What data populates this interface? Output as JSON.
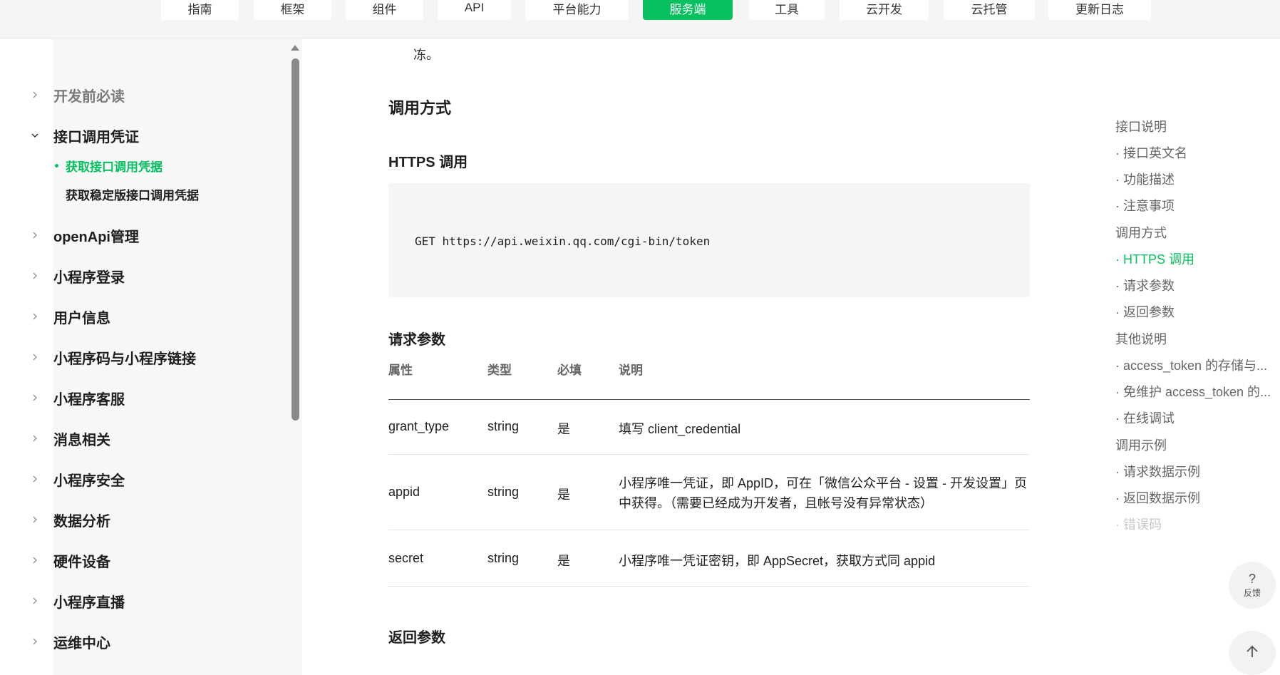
{
  "topnav": {
    "tabs": [
      {
        "label": "指南"
      },
      {
        "label": "框架"
      },
      {
        "label": "组件"
      },
      {
        "label": "API"
      },
      {
        "label": "平台能力"
      },
      {
        "label": "服务端",
        "active": true
      },
      {
        "label": "工具"
      },
      {
        "label": "云开发"
      },
      {
        "label": "云托管"
      },
      {
        "label": "更新日志"
      }
    ]
  },
  "sidebar": {
    "items": [
      {
        "label": "开发前必读",
        "expanded": false
      },
      {
        "label": "接口调用凭证",
        "expanded": true
      },
      {
        "label": "openApi管理",
        "expanded": false
      },
      {
        "label": "小程序登录",
        "expanded": false
      },
      {
        "label": "用户信息",
        "expanded": false
      },
      {
        "label": "小程序码与小程序链接",
        "expanded": false
      },
      {
        "label": "小程序客服",
        "expanded": false
      },
      {
        "label": "消息相关",
        "expanded": false
      },
      {
        "label": "小程序安全",
        "expanded": false
      },
      {
        "label": "数据分析",
        "expanded": false
      },
      {
        "label": "硬件设备",
        "expanded": false
      },
      {
        "label": "小程序直播",
        "expanded": false
      },
      {
        "label": "运维中心",
        "expanded": false
      }
    ],
    "subitems": [
      {
        "label": "获取接口调用凭据",
        "active": true
      },
      {
        "label": "获取稳定版接口调用凭据",
        "active": false
      }
    ]
  },
  "main": {
    "fragment_text": "冻。",
    "section_call": "调用方式",
    "section_https": "HTTPS 调用",
    "code": "GET https://api.weixin.qq.com/cgi-bin/token",
    "section_request": "请求参数",
    "table": {
      "headers": [
        "属性",
        "类型",
        "必填",
        "说明"
      ],
      "rows": [
        {
          "name": "grant_type",
          "type": "string",
          "required": "是",
          "desc": "填写 client_credential"
        },
        {
          "name": "appid",
          "type": "string",
          "required": "是",
          "desc": "小程序唯一凭证，即 AppID，可在「微信公众平台 - 设置 - 开发设置」页中获得。（需要已经成为开发者，且帐号没有异常状态）"
        },
        {
          "name": "secret",
          "type": "string",
          "required": "是",
          "desc": "小程序唯一凭证密钥，即 AppSecret，获取方式同 appid"
        }
      ]
    },
    "section_response": "返回参数"
  },
  "toc": {
    "items": [
      {
        "label": "接口说明",
        "level": 1
      },
      {
        "label": "· 接口英文名",
        "level": 2
      },
      {
        "label": "· 功能描述",
        "level": 2
      },
      {
        "label": "· 注意事项",
        "level": 2
      },
      {
        "label": "调用方式",
        "level": 1
      },
      {
        "label": "· HTTPS 调用",
        "level": 2,
        "active": true
      },
      {
        "label": "· 请求参数",
        "level": 2
      },
      {
        "label": "· 返回参数",
        "level": 2
      },
      {
        "label": "其他说明",
        "level": 1
      },
      {
        "label": "· access_token 的存储与...",
        "level": 2
      },
      {
        "label": "· 免维护 access_token 的...",
        "level": 2
      },
      {
        "label": "· 在线调试",
        "level": 2
      },
      {
        "label": "调用示例",
        "level": 1
      },
      {
        "label": "· 请求数据示例",
        "level": 2
      },
      {
        "label": "· 返回数据示例",
        "level": 2
      },
      {
        "label": "· 错误码",
        "level": 2,
        "faded": true
      }
    ]
  },
  "floating": {
    "feedback_icon": "?",
    "feedback_label": "反馈",
    "top_icon": "arrow-up-icon"
  },
  "colors": {
    "accent": "#07c160",
    "nav_bg": "#f5f5f5"
  }
}
